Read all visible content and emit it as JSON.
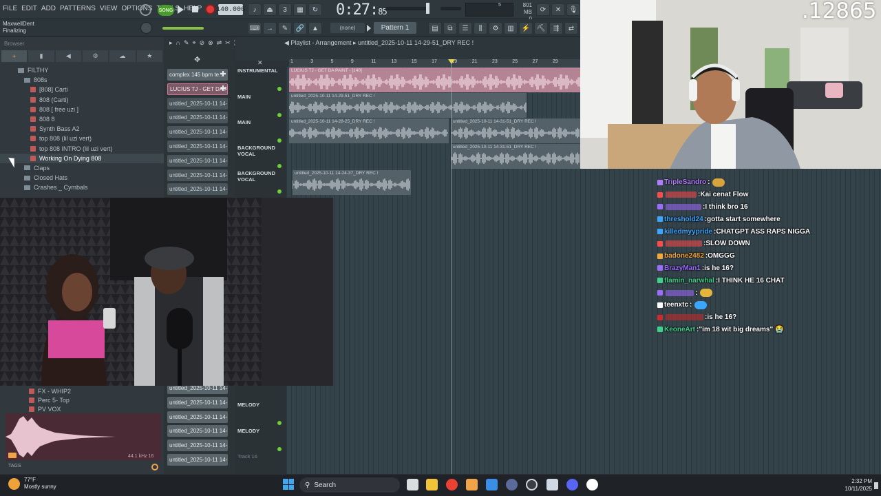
{
  "menu": {
    "items": [
      "FILE",
      "EDIT",
      "ADD",
      "PATTERNS",
      "VIEW",
      "OPTIONS",
      "TOOLS",
      "HELP"
    ],
    "song_label": "SONG",
    "tempo": "140.000",
    "time_main": "0:27:",
    "time_sub": "85",
    "cpu_line1": "801 MB",
    "cpu_line2": "0",
    "cpu_num": "5"
  },
  "hint_bar": {
    "line1": "MaxwellDent",
    "line2": "Finalizing"
  },
  "toolbar2": {
    "pattern_none": "(none)",
    "pattern_name": "Pattern 1"
  },
  "browser": {
    "label": "Browser",
    "tabs": [
      "+",
      "▮",
      "◀",
      "⚙",
      "☁",
      "★"
    ],
    "tree": [
      {
        "label": "FILTHY",
        "level": 0,
        "type": "folder"
      },
      {
        "label": "808s",
        "level": 1,
        "type": "folder"
      },
      {
        "label": "[808] Carti",
        "level": 2,
        "type": "file"
      },
      {
        "label": "808 (Carti)",
        "level": 2,
        "type": "file"
      },
      {
        "label": "808 [ free uzi ]",
        "level": 2,
        "type": "file"
      },
      {
        "label": "808 8",
        "level": 2,
        "type": "file"
      },
      {
        "label": "Synth Bass A2",
        "level": 2,
        "type": "file"
      },
      {
        "label": "top 808 (lil uzi vert)",
        "level": 2,
        "type": "file"
      },
      {
        "label": "top 808 INTRO (lil uzi vert)",
        "level": 2,
        "type": "file"
      },
      {
        "label": "Working On Dying 808",
        "level": 2,
        "type": "file",
        "highlight": true
      },
      {
        "label": "Claps",
        "level": 1,
        "type": "folder"
      },
      {
        "label": "Closed Hats",
        "level": 1,
        "type": "folder"
      },
      {
        "label": "Crashes _ Cymbals",
        "level": 1,
        "type": "folder"
      }
    ],
    "lower_items": [
      "FX - WHIP2",
      "Perc 5- Top",
      "PV VOX"
    ],
    "tags_label": "TAGS",
    "sample_info": "44.1 kHz 16"
  },
  "channels": {
    "top": [
      {
        "label": "complex 145 bpm te...",
        "style": "normal"
      },
      {
        "label": "LUCIUS TJ - GET DA P...",
        "style": "selected"
      },
      {
        "label": "untitled_2025-10-11 14-",
        "style": "dim"
      },
      {
        "label": "untitled_2025-10-11 14-",
        "style": "dim"
      },
      {
        "label": "untitled_2025-10-11 14-",
        "style": "dim"
      },
      {
        "label": "untitled_2025-10-11 14-",
        "style": "dim"
      },
      {
        "label": "untitled_2025-10-11 14-",
        "style": "dim"
      },
      {
        "label": "untitled_2025-10-11 14-",
        "style": "dim"
      },
      {
        "label": "untitled_2025-10-11 14-",
        "style": "dim"
      }
    ],
    "bottom": [
      {
        "label": "untitled_2025-10-11 14-"
      },
      {
        "label": "untitled_2025-10-11 14-"
      },
      {
        "label": "untitled_2025-10-11 14-"
      },
      {
        "label": "untitled_2025-10-11 14-"
      },
      {
        "label": "untitled_2025-10-11 14-"
      },
      {
        "label": "untitled_2025-10-11 14-"
      }
    ]
  },
  "playlist": {
    "title": "Playlist - Arrangement",
    "pattern": "untitled_2025-10-11 14-29-51_DRY REC !",
    "ruler": [
      "1",
      "3",
      "5",
      "9",
      "11",
      "13",
      "15",
      "17",
      "19",
      "21",
      "23",
      "25",
      "27",
      "29"
    ],
    "tracks": [
      {
        "name": "INSTRUMENTAL"
      },
      {
        "name": "MAIN"
      },
      {
        "name": "MAIN"
      },
      {
        "name": "BACKGROUND VOCAL"
      },
      {
        "name": "BACKGROUND VOCAL"
      },
      {
        "name": "MELODY"
      },
      {
        "name": "MELODY"
      },
      {
        "name": "Track 16"
      }
    ],
    "clips": [
      {
        "label": "LUCIUS TJ - GET DA PAINT - [140]",
        "color": "pink"
      },
      {
        "label": "untitled_2025-10-11 14-29-51_DRY REC !",
        "color": "grey"
      },
      {
        "label": "untitled_2025-10-11 14-28-25_DRY REC !",
        "color": "grey"
      },
      {
        "label": "untitled_2025-10-11 14-31-51_DRY REC !",
        "color": "grey"
      },
      {
        "label": "untitled_2025-10-11 14-31-51_DRY REC !",
        "color": "grey"
      },
      {
        "label": "untitled_2025-10-11 14-24-37_DRY REC !",
        "color": "grey"
      }
    ]
  },
  "stream": {
    "counter": ".12865"
  },
  "chat": [
    {
      "user": "TripleSandro",
      "color": "#b27cff",
      "msg": "",
      "emote": "#d7a33a"
    },
    {
      "user": "",
      "color": "#ff4a4a",
      "msg": "Kai cenat Flow"
    },
    {
      "user": "",
      "color": "#9c6bff",
      "msg": "I think bro 16"
    },
    {
      "user": "threshold24",
      "color": "#3aa6ff",
      "msg": "gotta start somewhere"
    },
    {
      "user": "killedmyypride",
      "color": "#3aa6ff",
      "msg": "CHATGPT ASS RAPS NIGGA"
    },
    {
      "user": "",
      "color": "#ff4a4a",
      "msg": "SLOW DOWN"
    },
    {
      "user": "badone2482",
      "color": "#f2a83a",
      "msg": "OMGGG"
    },
    {
      "user": "BrazyMan1",
      "color": "#9c6bff",
      "msg": "is he 16?"
    },
    {
      "user": "flamin_narwhal",
      "color": "#3fd08a",
      "msg": "I THINK HE 16 CHAT"
    },
    {
      "user": "",
      "color": "#9c6bff",
      "msg": "",
      "emote": "#e3b53a"
    },
    {
      "user": "teenxtc",
      "color": "#ffffff",
      "msg": "",
      "emote": "#3aa6ff"
    },
    {
      "user": "",
      "color": "#d22a2a",
      "msg": "is he 16?"
    },
    {
      "user": "KeoneArt",
      "color": "#3fd08a",
      "msg": "\"im 18 wit big dreams\" 😭"
    }
  ],
  "taskbar": {
    "temp": "77°F",
    "weather": "Mostly sunny",
    "search": "Search",
    "time": "2:32 PM",
    "date": "10/11/2025"
  },
  "colors": {
    "accent_orange": "#f0a44a",
    "clip_pink": "#b48494",
    "led_green": "#6ecf3a",
    "record_red": "#e03a3a"
  }
}
